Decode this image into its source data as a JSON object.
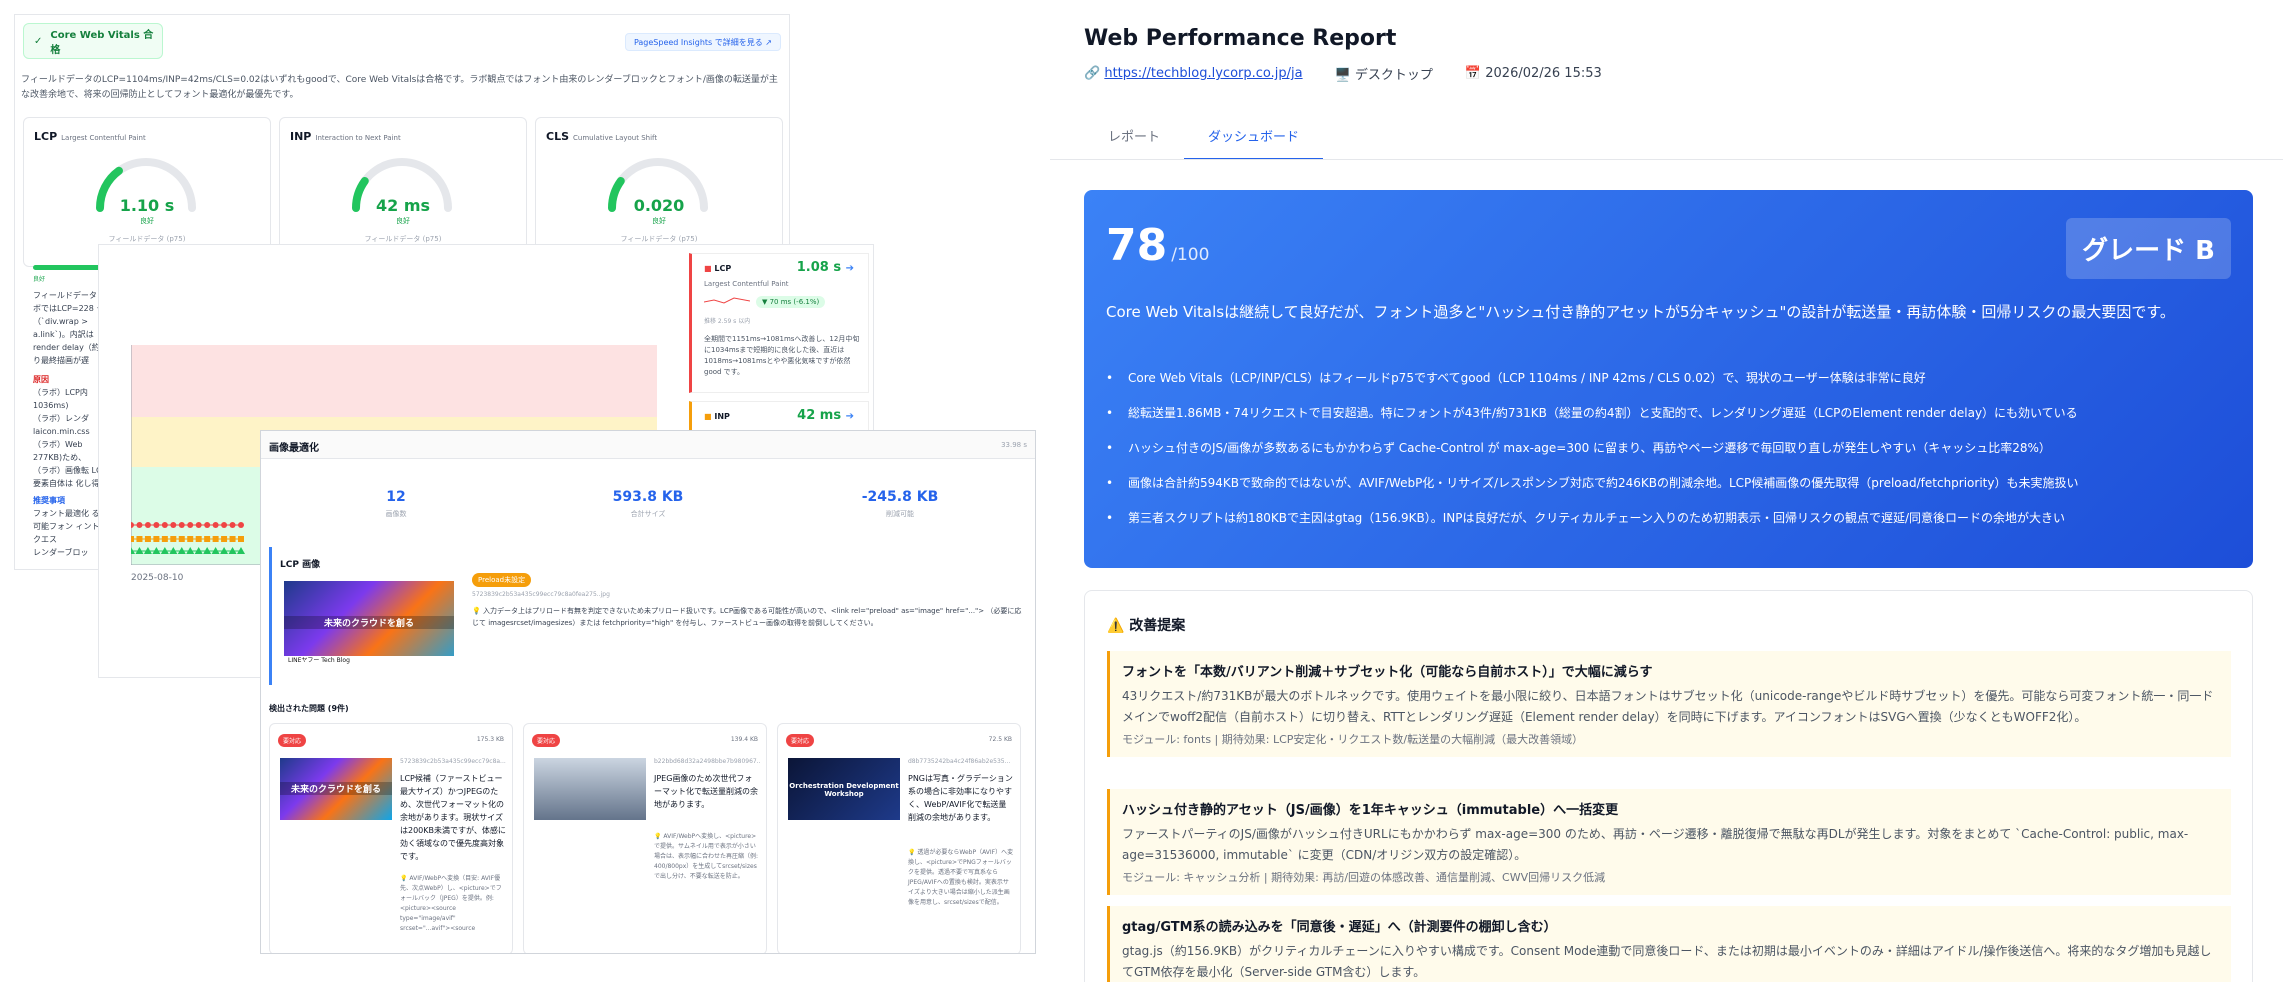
{
  "cwv": {
    "badge": "Core Web Vitals 合格",
    "psi_link": "PageSpeed Insights で詳細を見る ↗",
    "summary": "フィールドデータのLCP=1104ms/INP=42ms/CLS=0.02はいずれもgoodで、Core Web Vitalsは合格です。ラボ観点ではフォント由来のレンダーブロックとフォント/画像の転送量が主な改善余地で、将来の回帰防止としてフォント最適化が最優先です。",
    "metrics": [
      {
        "abbr": "LCP",
        "full": "Largest Contentful Paint",
        "value": "1.10 s",
        "status": "良好",
        "field": "フィールドデータ (p75)",
        "level": 0.3
      },
      {
        "abbr": "INP",
        "full": "Interaction to Next Paint",
        "value": "42 ms",
        "status": "良好",
        "field": "フィールドデータ (p75)",
        "level": 0.2
      },
      {
        "abbr": "CLS",
        "full": "Cumulative Layout Shift",
        "value": "0.020",
        "status": "良好",
        "field": "フィールドデータ (p75)",
        "level": 0.2
      }
    ],
    "good_label": "良好",
    "left_text": "フィールドデータ ラボではLCP=228 ク（`div.wrap > a.link`)。内訳は render delay（約 より最終描画が遅",
    "cause_label": "原因",
    "causes": [
      "（ラボ）LCP内 1036ms)",
      "（ラボ）レンダ laicon.min.css",
      "（ラボ）Web 277KB)ため、",
      "（ラボ）画像転 LCP要素自体は 化し得る"
    ],
    "rec_label": "推奨事項",
    "recs": [
      "フォント最適化 る、可能フォン ィントリクエス",
      "レンダーブロッ"
    ]
  },
  "chart": {
    "date": "2025-08-10",
    "lcp": {
      "title": "LCP",
      "value": "1.08 s",
      "sub": "Largest Contentful Paint",
      "change": "▼ 70 ms (-6.1%)",
      "meta": "推移 2.59 s 以内",
      "text": "全期間で1151ms→1081msへ改善し、12月中旬に1034msまで短期的に良化した後、直近は1018ms→1081msとやや悪化気味ですが依然good です。"
    },
    "inp": {
      "title": "INP",
      "value": "42 ms"
    },
    "series_red": [
      1,
      1,
      1,
      1,
      1,
      1,
      1,
      1,
      1,
      1,
      1,
      1,
      1,
      1
    ],
    "series_orange": [
      1,
      1,
      1,
      1,
      1,
      1,
      1,
      1,
      1,
      1,
      1,
      1,
      1,
      1
    ],
    "series_green": [
      1,
      1,
      1,
      1,
      1,
      1,
      1,
      1,
      1,
      1,
      1,
      1,
      1,
      1
    ]
  },
  "img": {
    "title": "画像最適化",
    "time": "33.98 s",
    "stats": [
      {
        "n": "12",
        "l": "画像数"
      },
      {
        "n": "593.8 KB",
        "l": "合計サイズ"
      },
      {
        "n": "-245.8 KB",
        "l": "削減可能"
      }
    ],
    "lcp_title": "LCP 画像",
    "thumb_caption": "未来のクラウドを創る",
    "thumb_brand": "LINEヤフー Tech Blog",
    "preload": "Preload未設定",
    "lcp_file": "5723839c2b53a435c99ecc79c8a0fea275..jpg",
    "lcp_text": "💡 入力データ上はプリロード有無を判定できないため未プリロード扱いです。LCP画像である可能性が高いので、<link rel=\"preload\" as=\"image\" href=\"...\"> （必要に応じて imagesrcset/imagesizes）または fetchpriority=\"high\" を付与し、ファーストビュー画像の取得を前倒ししてください。",
    "issues_title": "検出された問題 (9件)",
    "issues": [
      {
        "badge": "要対応",
        "size": "175.3 KB",
        "file": "5723839c2b53a435c99ecc79c8a...",
        "text": "LCP候補（ファーストビュー最大サイズ）かつJPEGのため、次世代フォーマット化の余地があります。現状サイズは200KB未満ですが、体感に効く領域なので優先度高対象です。",
        "sugg": "💡 AVIF/WebPへ変換（目安: AVIF優先、次点WebP）し、<picture>でフォールバック（JPEG）を提供。例: <picture><source type=\"image/avif\" srcset=\"...avif\"><source",
        "caption": "未来のクラウドを創る"
      },
      {
        "badge": "要対応",
        "size": "139.4 KB",
        "file": "b22bbd68d32a2498bbe7b980967...",
        "text": "JPEG画像のため次世代フォーマット化で転送量削減の余地があります。",
        "sugg": "💡 AVIF/WebPへ変換し、<picture>で提供。サムネイル用で表示が小さい場合は、表示幅に合わせた再圧縮（例: 400/800px）を生成してsrcset/sizesで出し分け、不要な転送を防止。",
        "caption": ""
      },
      {
        "badge": "要対応",
        "size": "72.5 KB",
        "file": "d8b7735242ba4c24f86ab2e535...",
        "text": "PNGは写真・グラデーション系の場合に非効率になりやすく、WebP/AVIF化で転送量削減の余地があります。",
        "sugg": "💡 透過が必要ならWebP（AVIF）へ変換し、<picture>でPNGフォールバックを提供。透過不要で写真系ならJPEG/AVIFへの置換も検討。実表示サイズより大きい場合は縮小した派生画像を用意し、srcset/sizesで配信。",
        "caption": "Orchestration Development Workshop"
      }
    ]
  },
  "report": {
    "title": "Web Performance Report",
    "url": "https://techblog.lycorp.co.jp/ja",
    "device": "デスクトップ",
    "datetime": "2026/02/26 15:53",
    "tabs": [
      "レポート",
      "ダッシュボード"
    ],
    "score": "78",
    "score_max": "/100",
    "grade": "グレード B",
    "lead": "Core Web Vitalsは継続して良好だが、フォント過多と\"ハッシュ付き静的アセットが5分キャッシュ\"の設計が転送量・再訪体験・回帰リスクの最大要因です。",
    "bullets": [
      "Core Web Vitals（LCP/INP/CLS）はフィールドp75ですべてgood（LCP 1104ms / INP 42ms / CLS 0.02）で、現状のユーザー体験は非常に良好",
      "総転送量1.86MB・74リクエストで目安超過。特にフォントが43件/約731KB（総量の約4割）と支配的で、レンダリング遅延（LCPのElement render delay）にも効いている",
      "ハッシュ付きのJS/画像が多数あるにもかかわらず Cache-Control が max-age=300 に留まり、再訪やページ遷移で毎回取り直しが発生しやすい（キャッシュ比率28%）",
      "画像は合計約594KBで致命的ではないが、AVIF/WebP化・リサイズ/レスポンシブ対応で約246KBの削減余地。LCP候補画像の優先取得（preload/fetchpriority）も未実施扱い",
      "第三者スクリプトは約180KBで主因はgtag（156.9KB）。INPは良好だが、クリティカルチェーン入りのため初期表示・回帰リスクの観点で遅延/同意後ロードの余地が大きい"
    ],
    "suggestions_title": "⚠️ 改善提案",
    "suggestions": [
      {
        "title": "フォントを「本数/バリアント削減＋サブセット化（可能なら自前ホスト）」で大幅に減らす",
        "desc": "43リクエスト/約731KBが最大のボトルネックです。使用ウェイトを最小限に絞り、日本語フォントはサブセット化（unicode-rangeやビルド時サブセット）を優先。可能なら可変フォント統一・同一ドメインでwoff2配信（自前ホスト）に切り替え、RTTとレンダリング遅延（Element render delay）を同時に下げます。アイコンフォントはSVGへ置換（少なくともWOFF2化）。",
        "meta": "モジュール: fonts | 期待効果: LCP安定化・リクエスト数/転送量の大幅削減（最大改善領域）"
      },
      {
        "title": "ハッシュ付き静的アセット（JS/画像）を1年キャッシュ（immutable）へ一括変更",
        "desc": "ファーストパーティのJS/画像がハッシュ付きURLにもかかわらず max-age=300 のため、再訪・ページ遷移・離脱復帰で無駄な再DLが発生します。対象をまとめて `Cache-Control: public, max-age=31536000, immutable` に変更（CDN/オリジン双方の設定確認）。",
        "meta": "モジュール: キャッシュ分析 | 期待効果: 再訪/回遊の体感改善、通信量削減、CWV回帰リスク低減"
      },
      {
        "title": "gtag/GTM系の読み込みを「同意後・遅延」へ（計測要件の棚卸し含む）",
        "desc": "gtag.js（約156.9KB）がクリティカルチェーンに入りやすい構成です。Consent Mode連動で同意後ロード、または初期は最小イベントのみ・詳細はアイドル/操作後送信へ。将来的なタグ増加も見越してGTM依存を最小化（Server-side GTM含む）します。",
        "meta": ""
      }
    ]
  },
  "icons": {
    "check": "check-icon",
    "link": "link-icon",
    "monitor": "monitor-icon",
    "calendar": "calendar-icon",
    "warning": "warning-icon"
  },
  "colors": {
    "accent": "#2563eb",
    "good": "#16a34a",
    "hero_start": "#3b82f6",
    "hero_end": "#1d4ed8"
  }
}
